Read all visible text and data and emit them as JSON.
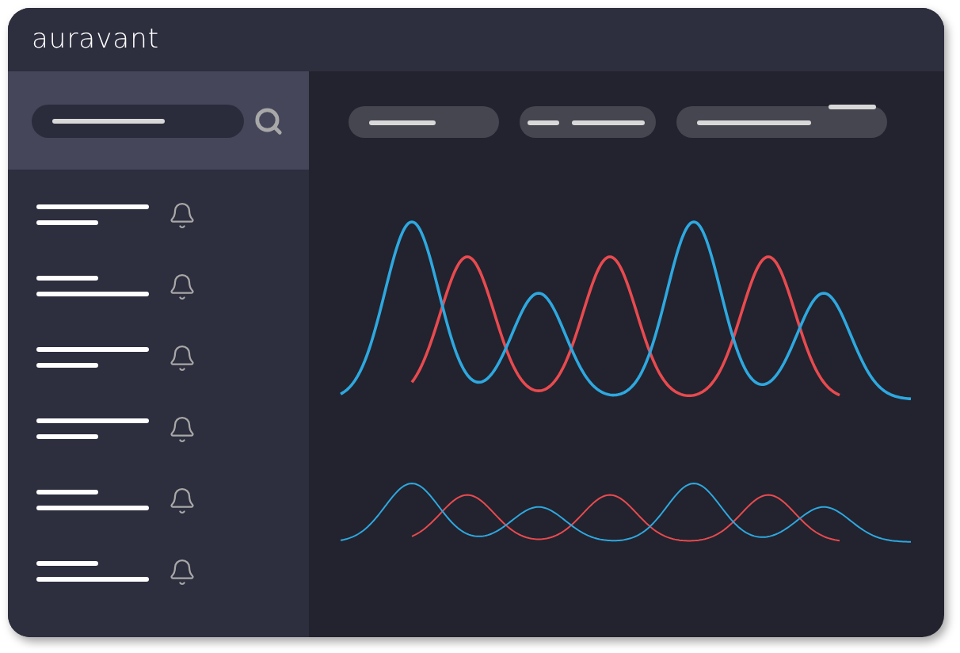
{
  "logo": "auravant",
  "filters": [
    {
      "kind": "single"
    },
    {
      "kind": "double"
    },
    {
      "kind": "flagged"
    }
  ],
  "alerts": [
    {
      "kind": "long_short"
    },
    {
      "kind": "short_long"
    },
    {
      "kind": "long_short"
    },
    {
      "kind": "long_short"
    },
    {
      "kind": "short_long"
    },
    {
      "kind": "short_long"
    }
  ]
}
